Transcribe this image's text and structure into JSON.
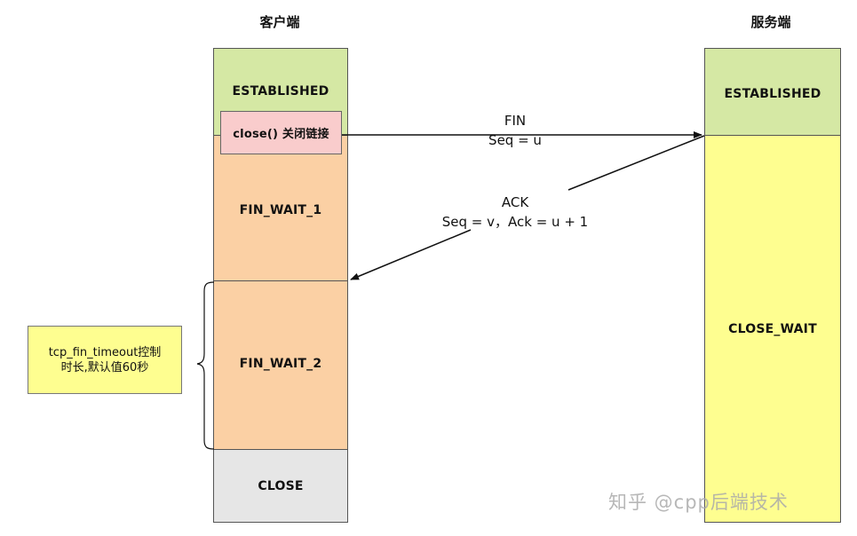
{
  "client": {
    "title": "客户端",
    "states": {
      "established": "ESTABLISHED",
      "fin_wait_1": "FIN_WAIT_1",
      "fin_wait_2": "FIN_WAIT_2",
      "close": "CLOSE"
    },
    "close_call": "close() 关闭链接"
  },
  "server": {
    "title": "服务端",
    "states": {
      "established": "ESTABLISHED",
      "close_wait": "CLOSE_WAIT"
    }
  },
  "messages": {
    "fin": {
      "line1": "FIN",
      "line2": "Seq = u"
    },
    "ack": {
      "line1": "ACK",
      "line2": "Seq = v，Ack = u + 1"
    }
  },
  "timeout_note": {
    "line1": "tcp_fin_timeout控制",
    "line2": "时长,默认值60秒"
  },
  "watermark": "知乎 @cpp后端技术",
  "colors": {
    "established": "#d5e8a4",
    "fin_wait": "#fbd0a4",
    "close": "#e6e6e6",
    "close_wait": "#fefe90",
    "close_call": "#f9cccc",
    "note": "#fefe90"
  }
}
